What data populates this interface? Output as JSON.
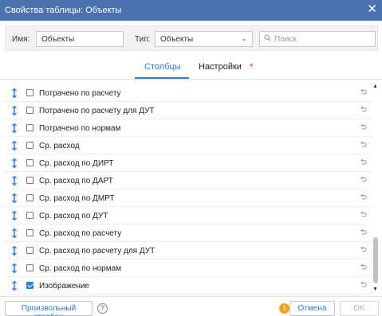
{
  "window": {
    "title": "Свойства таблицы: Объекты",
    "close_glyph": "✕"
  },
  "filters": {
    "name_label": "Имя:",
    "name_value": "Объекты",
    "type_label": "Тип:",
    "type_value": "Объекты",
    "type_chevron": "⌄",
    "search_placeholder": "Поиск"
  },
  "tabs": {
    "columns": "Столбцы",
    "settings": "Настройки",
    "modified_marker": "*"
  },
  "columns": [
    {
      "label": "Потрачено по расчету",
      "checked": false
    },
    {
      "label": "Потрачено по расчету для ДУТ",
      "checked": false
    },
    {
      "label": "Потрачено по нормам",
      "checked": false
    },
    {
      "label": "Ср. расход",
      "checked": false
    },
    {
      "label": "Ср. расход по ДИРТ",
      "checked": false
    },
    {
      "label": "Ср. расход по ДАРТ",
      "checked": false
    },
    {
      "label": "Ср. расход по ДМРТ",
      "checked": false
    },
    {
      "label": "Ср. расход по ДУТ",
      "checked": false
    },
    {
      "label": "Ср. расход по расчету",
      "checked": false
    },
    {
      "label": "Ср. расход по расчету для ДУТ",
      "checked": false
    },
    {
      "label": "Ср. расход по нормам",
      "checked": false
    },
    {
      "label": "Изображение",
      "checked": true
    }
  ],
  "scroll": {
    "up_glyph": "▲",
    "down_glyph": "▼"
  },
  "footer": {
    "custom_column_button": "Произвольный столбец",
    "help_glyph": "?",
    "warning_glyph": "!",
    "cancel_button": "Отмена",
    "ok_button": "OK"
  },
  "colors": {
    "titlebar": "#4a72b0",
    "accent": "#2e7fd9",
    "warning": "#f5a21b",
    "modified_dot": "#e53935"
  },
  "icons": {
    "row_drag": "drag-handle-icon",
    "row_reset": "reset-arrow-icon",
    "search": "search-icon",
    "help": "help-icon",
    "warning": "warning-icon",
    "close": "close-icon"
  }
}
